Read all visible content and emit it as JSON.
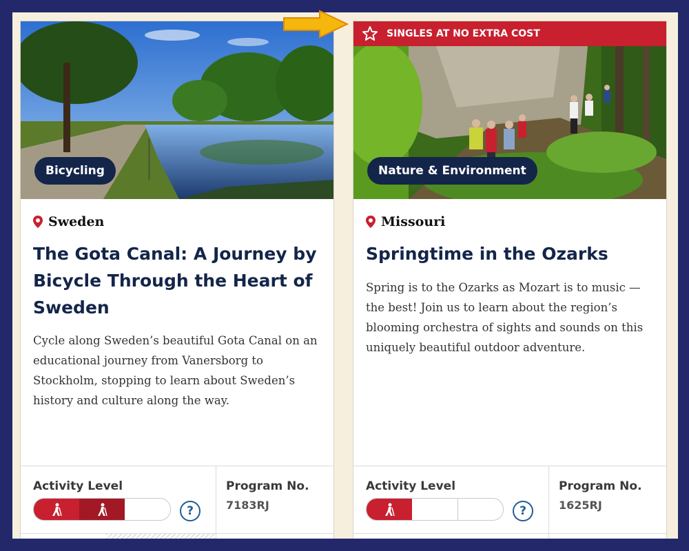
{
  "colors": {
    "page_border": "#23286b",
    "banner_red": "#c8202f",
    "pill_navy": "#14254a",
    "title_navy": "#14254a",
    "help_blue": "#1f5c97",
    "arrow_yellow": "#f5b60e"
  },
  "cards": [
    {
      "category": "Bicycling",
      "location": "Sweden",
      "title": "The Gota Canal: A Journey by Bicycle Through the Heart of Sweden",
      "description": "Cycle along Sweden’s beautiful Gota Canal on an educational journey from Vanersborg to Stockholm, stopping to learn about Sweden’s history and culture along the way.",
      "activity_label": "Activity Level",
      "activity_level": 2,
      "activity_max": 3,
      "help_label": "?",
      "program_label": "Program No.",
      "program_number": "7183RJ"
    },
    {
      "banner": "SINGLES AT NO EXTRA COST",
      "category": "Nature & Environment",
      "location": "Missouri",
      "title": "Springtime in the Ozarks",
      "description": "Spring is to the Ozarks as Mozart is to music — the best! Join us to learn about the region’s blooming orchestra of sights and sounds on this uniquely beautiful outdoor adventure.",
      "activity_label": "Activity Level",
      "activity_level": 1,
      "activity_max": 3,
      "help_label": "?",
      "program_label": "Program No.",
      "program_number": "1625RJ"
    }
  ]
}
